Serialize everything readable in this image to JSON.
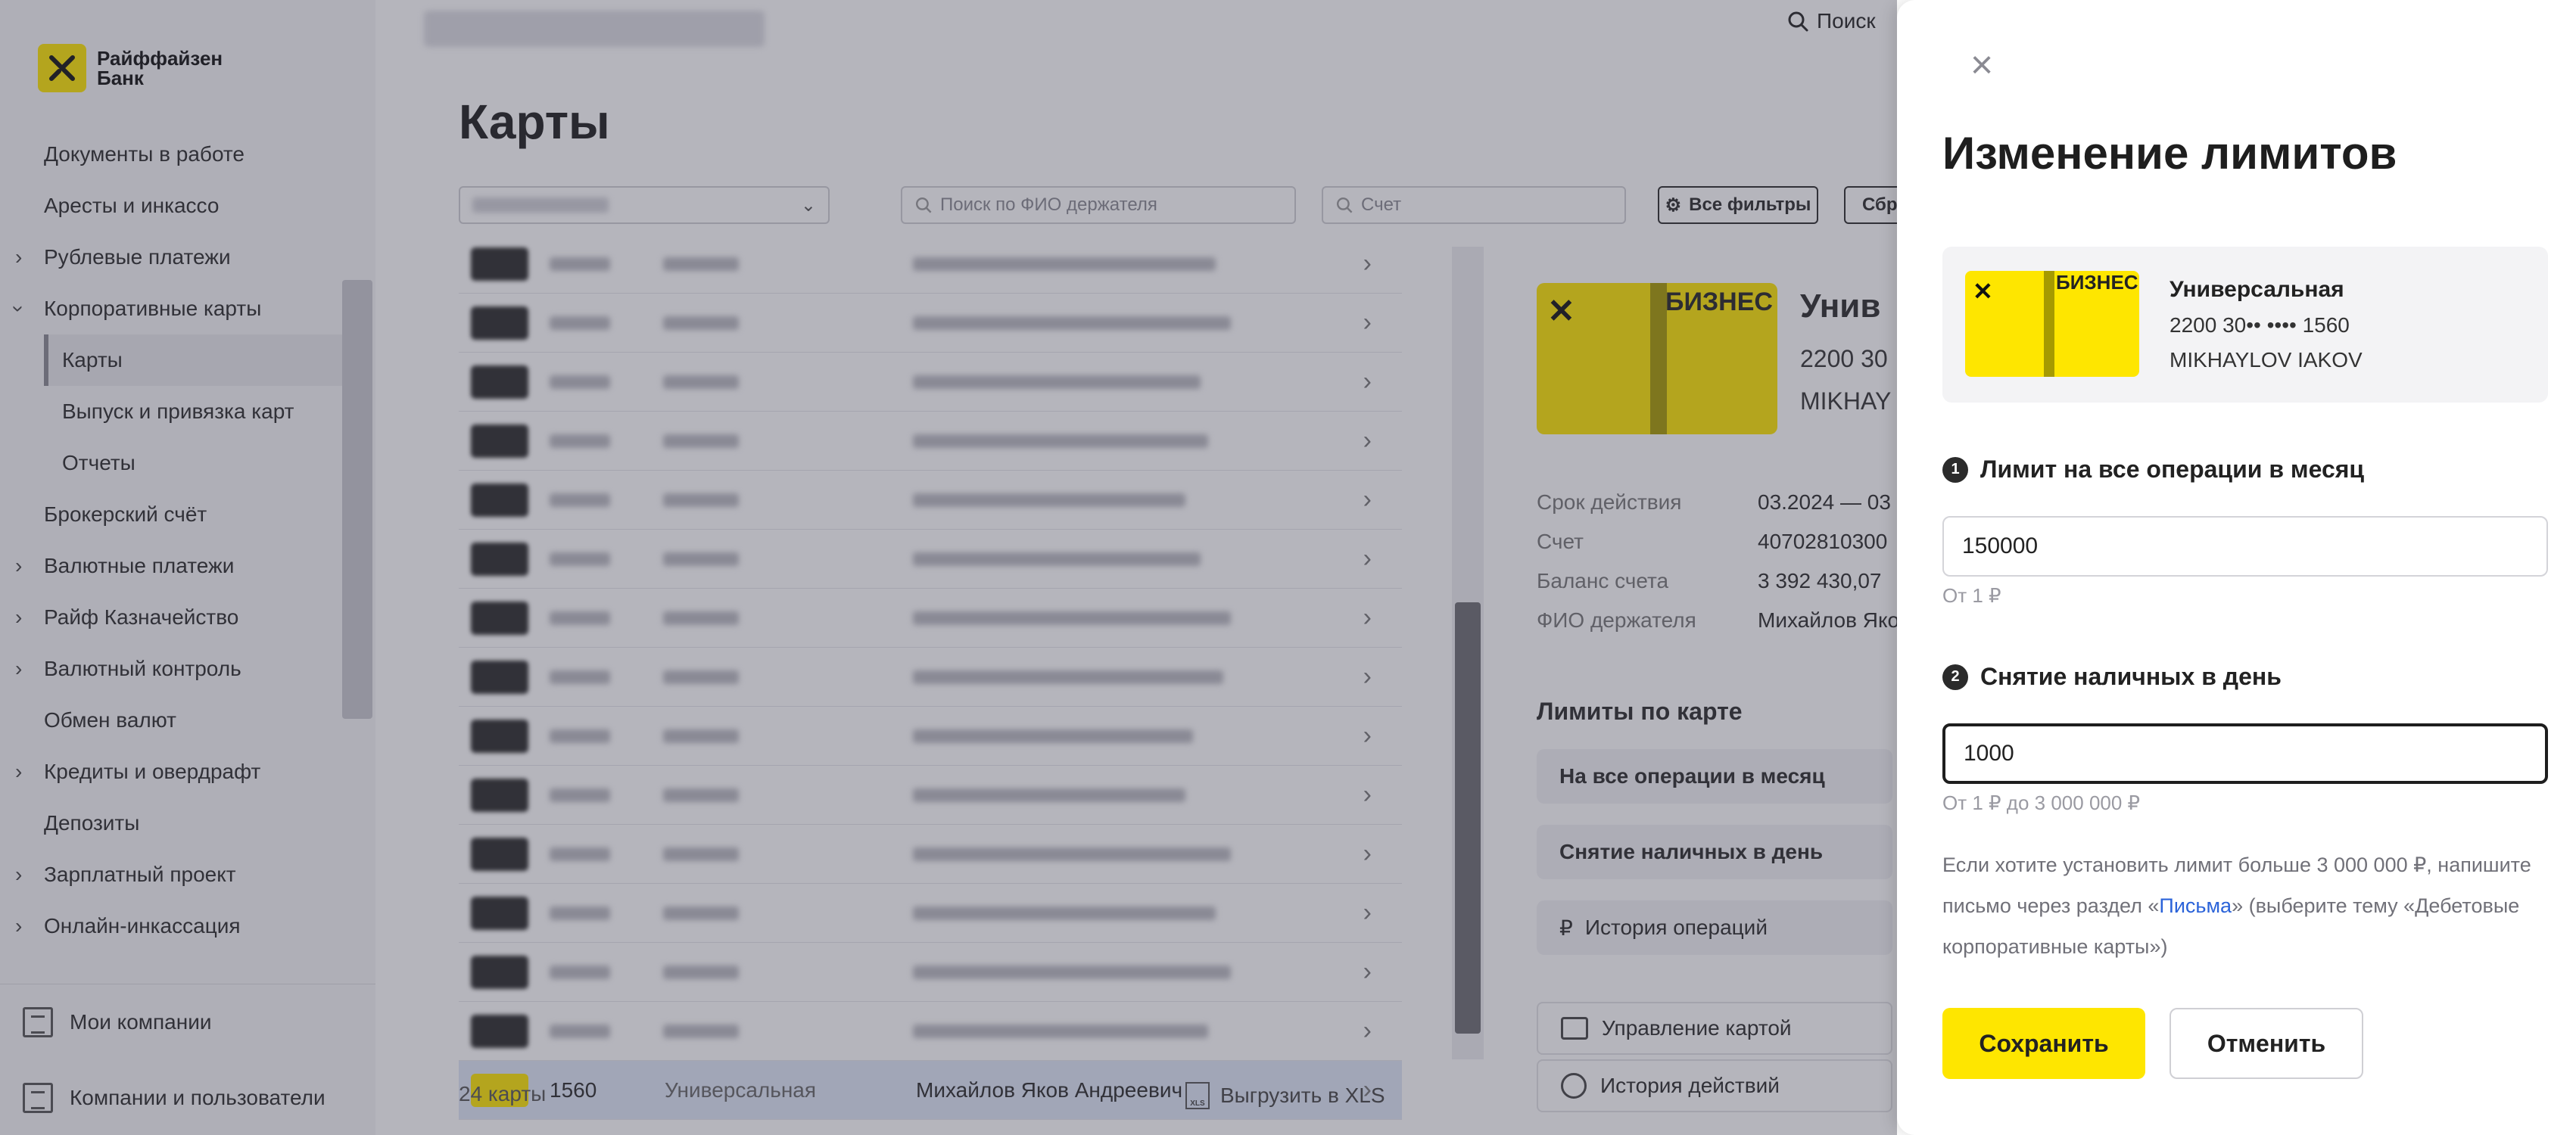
{
  "brand": {
    "logo_line1": "Райффайзен",
    "logo_line2": "Банк",
    "accent": "#fee600"
  },
  "header": {
    "search_label": "Поиск"
  },
  "sidebar": {
    "items": [
      {
        "label": "Документы в работе",
        "expandable": false
      },
      {
        "label": "Аресты и инкассо",
        "expandable": false
      },
      {
        "label": "Рублевые платежи",
        "expandable": true
      },
      {
        "label": "Корпоративные карты",
        "expandable": true,
        "expanded": true
      }
    ],
    "subitems": [
      {
        "label": "Карты",
        "active": true
      },
      {
        "label": "Выпуск и привязка карт"
      },
      {
        "label": "Отчеты"
      }
    ],
    "items_after": [
      {
        "label": "Брокерский счёт",
        "expandable": false
      },
      {
        "label": "Валютные платежи",
        "expandable": true
      },
      {
        "label": "Райф Казначейство",
        "expandable": true
      },
      {
        "label": "Валютный контроль",
        "expandable": true
      },
      {
        "label": "Обмен валют",
        "expandable": false
      },
      {
        "label": "Кредиты и овердрафт",
        "expandable": true
      },
      {
        "label": "Депозиты",
        "expandable": false
      },
      {
        "label": "Зарплатный проект",
        "expandable": true
      },
      {
        "label": "Онлайн-инкассация",
        "expandable": true
      }
    ],
    "bottom": [
      {
        "label": "Мои компании",
        "icon": "building-icon"
      },
      {
        "label": "Компании и пользователи",
        "icon": "building-icon"
      }
    ]
  },
  "main": {
    "title": "Карты",
    "filters": {
      "holder_placeholder": "Поиск по ФИО держателя",
      "account_placeholder": "Счет",
      "all_filters": "Все фильтры",
      "reset": "Сбр"
    },
    "selected_row": {
      "last4": "1560",
      "type": "Универсальная",
      "holder": "Михайлов Яков Андреевич"
    },
    "footer_count": "24 карты",
    "export_label": "Выгрузить в XLS"
  },
  "detail": {
    "card_badge": "БИЗНЕС",
    "title": "Унив",
    "number": "2200 30",
    "holder": "MIKHAY",
    "fields": [
      {
        "label": "Срок действия",
        "value": "03.2024 — 03"
      },
      {
        "label": "Счет",
        "value": "40702810300"
      },
      {
        "label": "Баланс счета",
        "value": "3 392 430,07"
      },
      {
        "label": "ФИО держателя",
        "value": "Михайлов Яко"
      }
    ],
    "limits_title": "Лимиты по карте",
    "limits": [
      "На все операции в месяц",
      "Снятие наличных в день"
    ],
    "history": "История операций",
    "manage": "Управление картой",
    "actions_history": "История действий"
  },
  "modal": {
    "title": "Изменение лимитов",
    "card": {
      "badge": "БИЗНЕС",
      "name": "Универсальная",
      "number": "2200 30•• •••• 1560",
      "holder": "MIKHAYLOV IAKOV"
    },
    "field1": {
      "step": "1",
      "label": "Лимит на все операции в месяц",
      "value": "150000",
      "hint": "От 1 ₽"
    },
    "field2": {
      "step": "2",
      "label": "Снятие наличных в день",
      "value": "1000",
      "hint": "От 1 ₽ до 3 000 000 ₽"
    },
    "note_before": "Если хотите установить лимит больше 3 000 000 ₽, напишите письмо через раздел «",
    "note_link": "Письма",
    "note_after": "» (выберите тему «Дебетовые корпоративные карты»)",
    "save": "Сохранить",
    "cancel": "Отменить"
  }
}
